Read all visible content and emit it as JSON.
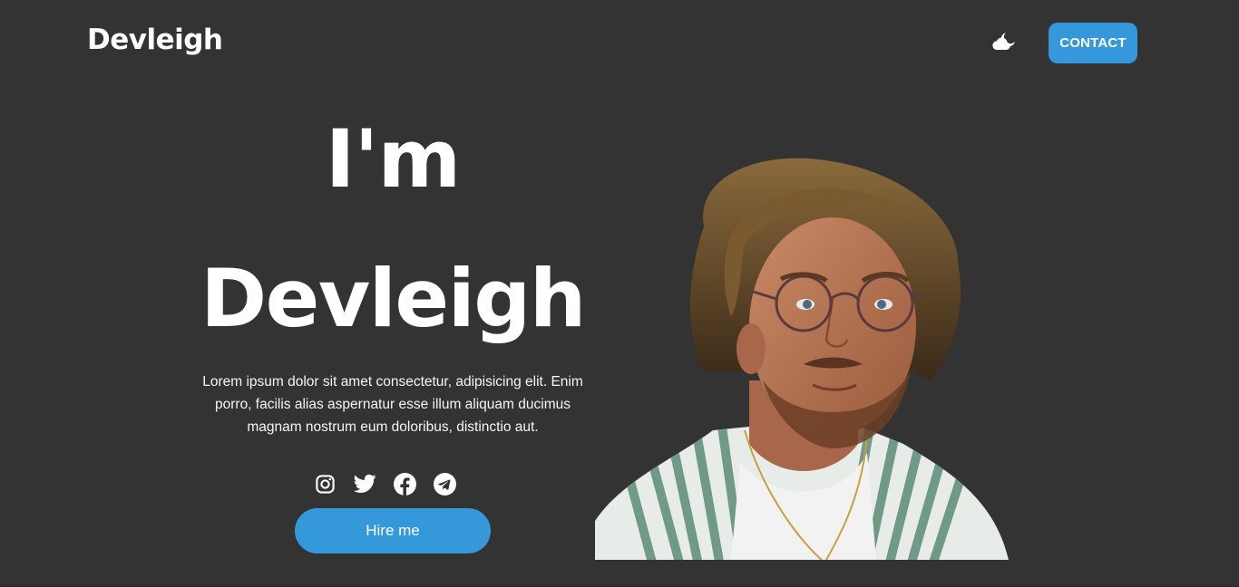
{
  "header": {
    "logo": "Devleigh",
    "theme_toggle_icon": "moon-cloud-icon",
    "contact_label": "CONTACT"
  },
  "hero": {
    "line1": "I'm",
    "line2": "Devleigh",
    "description": "Lorem ipsum dolor sit amet consectetur, adipisicing elit. Enim porro, facilis alias aspernatur esse illum aliquam ducimus magnam nostrum eum doloribus, distinctio aut.",
    "socials": [
      "instagram-icon",
      "twitter-icon",
      "facebook-icon",
      "telegram-icon"
    ],
    "cta_label": "Hire me"
  },
  "colors": {
    "background": "#333333",
    "accent": "#3498db",
    "text": "#ffffff"
  }
}
